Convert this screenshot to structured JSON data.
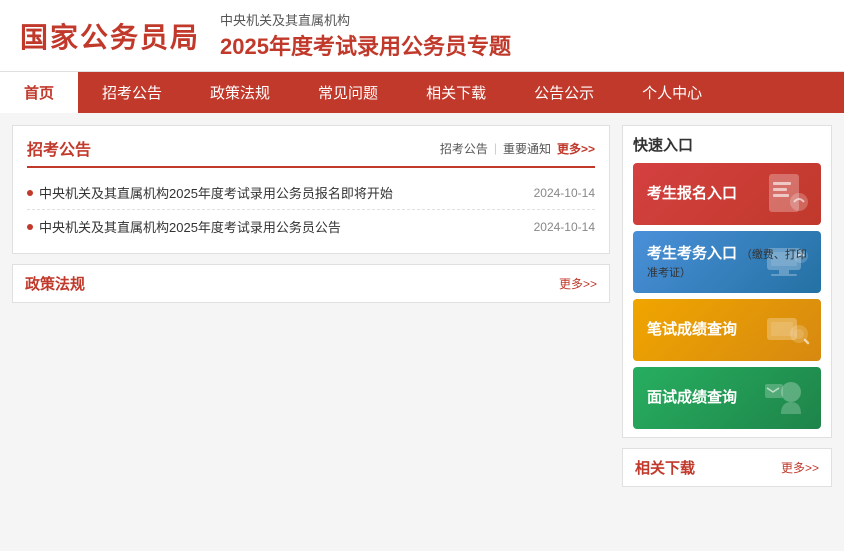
{
  "header": {
    "logo": "国家公务员局",
    "subtitle": "中央机关及其直属机构",
    "main_title": "2025年度考试录用公务员专题"
  },
  "nav": {
    "items": [
      {
        "label": "首页",
        "active": true
      },
      {
        "label": "招考公告",
        "active": false
      },
      {
        "label": "政策法规",
        "active": false
      },
      {
        "label": "常见问题",
        "active": false
      },
      {
        "label": "相关下载",
        "active": false
      },
      {
        "label": "公告公示",
        "active": false
      },
      {
        "label": "个人中心",
        "active": false
      }
    ]
  },
  "announcement": {
    "title": "招考公告",
    "filter_links": [
      "招考公告",
      "重要通知"
    ],
    "more_text": "更多>>",
    "news": [
      {
        "title": "中央机关及其直属机构2025年度考试录用公务员报名即将开始",
        "date": "2024-10-14"
      },
      {
        "title": "中央机关及其直属机构2025年度考试录用公务员公告",
        "date": "2024-10-14"
      }
    ]
  },
  "quick_access": {
    "title": "快速入口",
    "buttons": [
      {
        "label": "考生报名入口",
        "sub": "",
        "color": "red",
        "icon": "📋"
      },
      {
        "label": "考生考务入口",
        "sub": "（缴费、打印准考证）",
        "color": "blue",
        "icon": "💻"
      },
      {
        "label": "笔试成绩查询",
        "sub": "",
        "color": "orange",
        "icon": "🔍"
      },
      {
        "label": "面试成绩查询",
        "sub": "",
        "color": "green",
        "icon": "👤"
      }
    ]
  },
  "policy": {
    "title": "政策法规",
    "more_text": "更多>>"
  },
  "download": {
    "title": "相关下载",
    "more_text": "更多>>"
  }
}
